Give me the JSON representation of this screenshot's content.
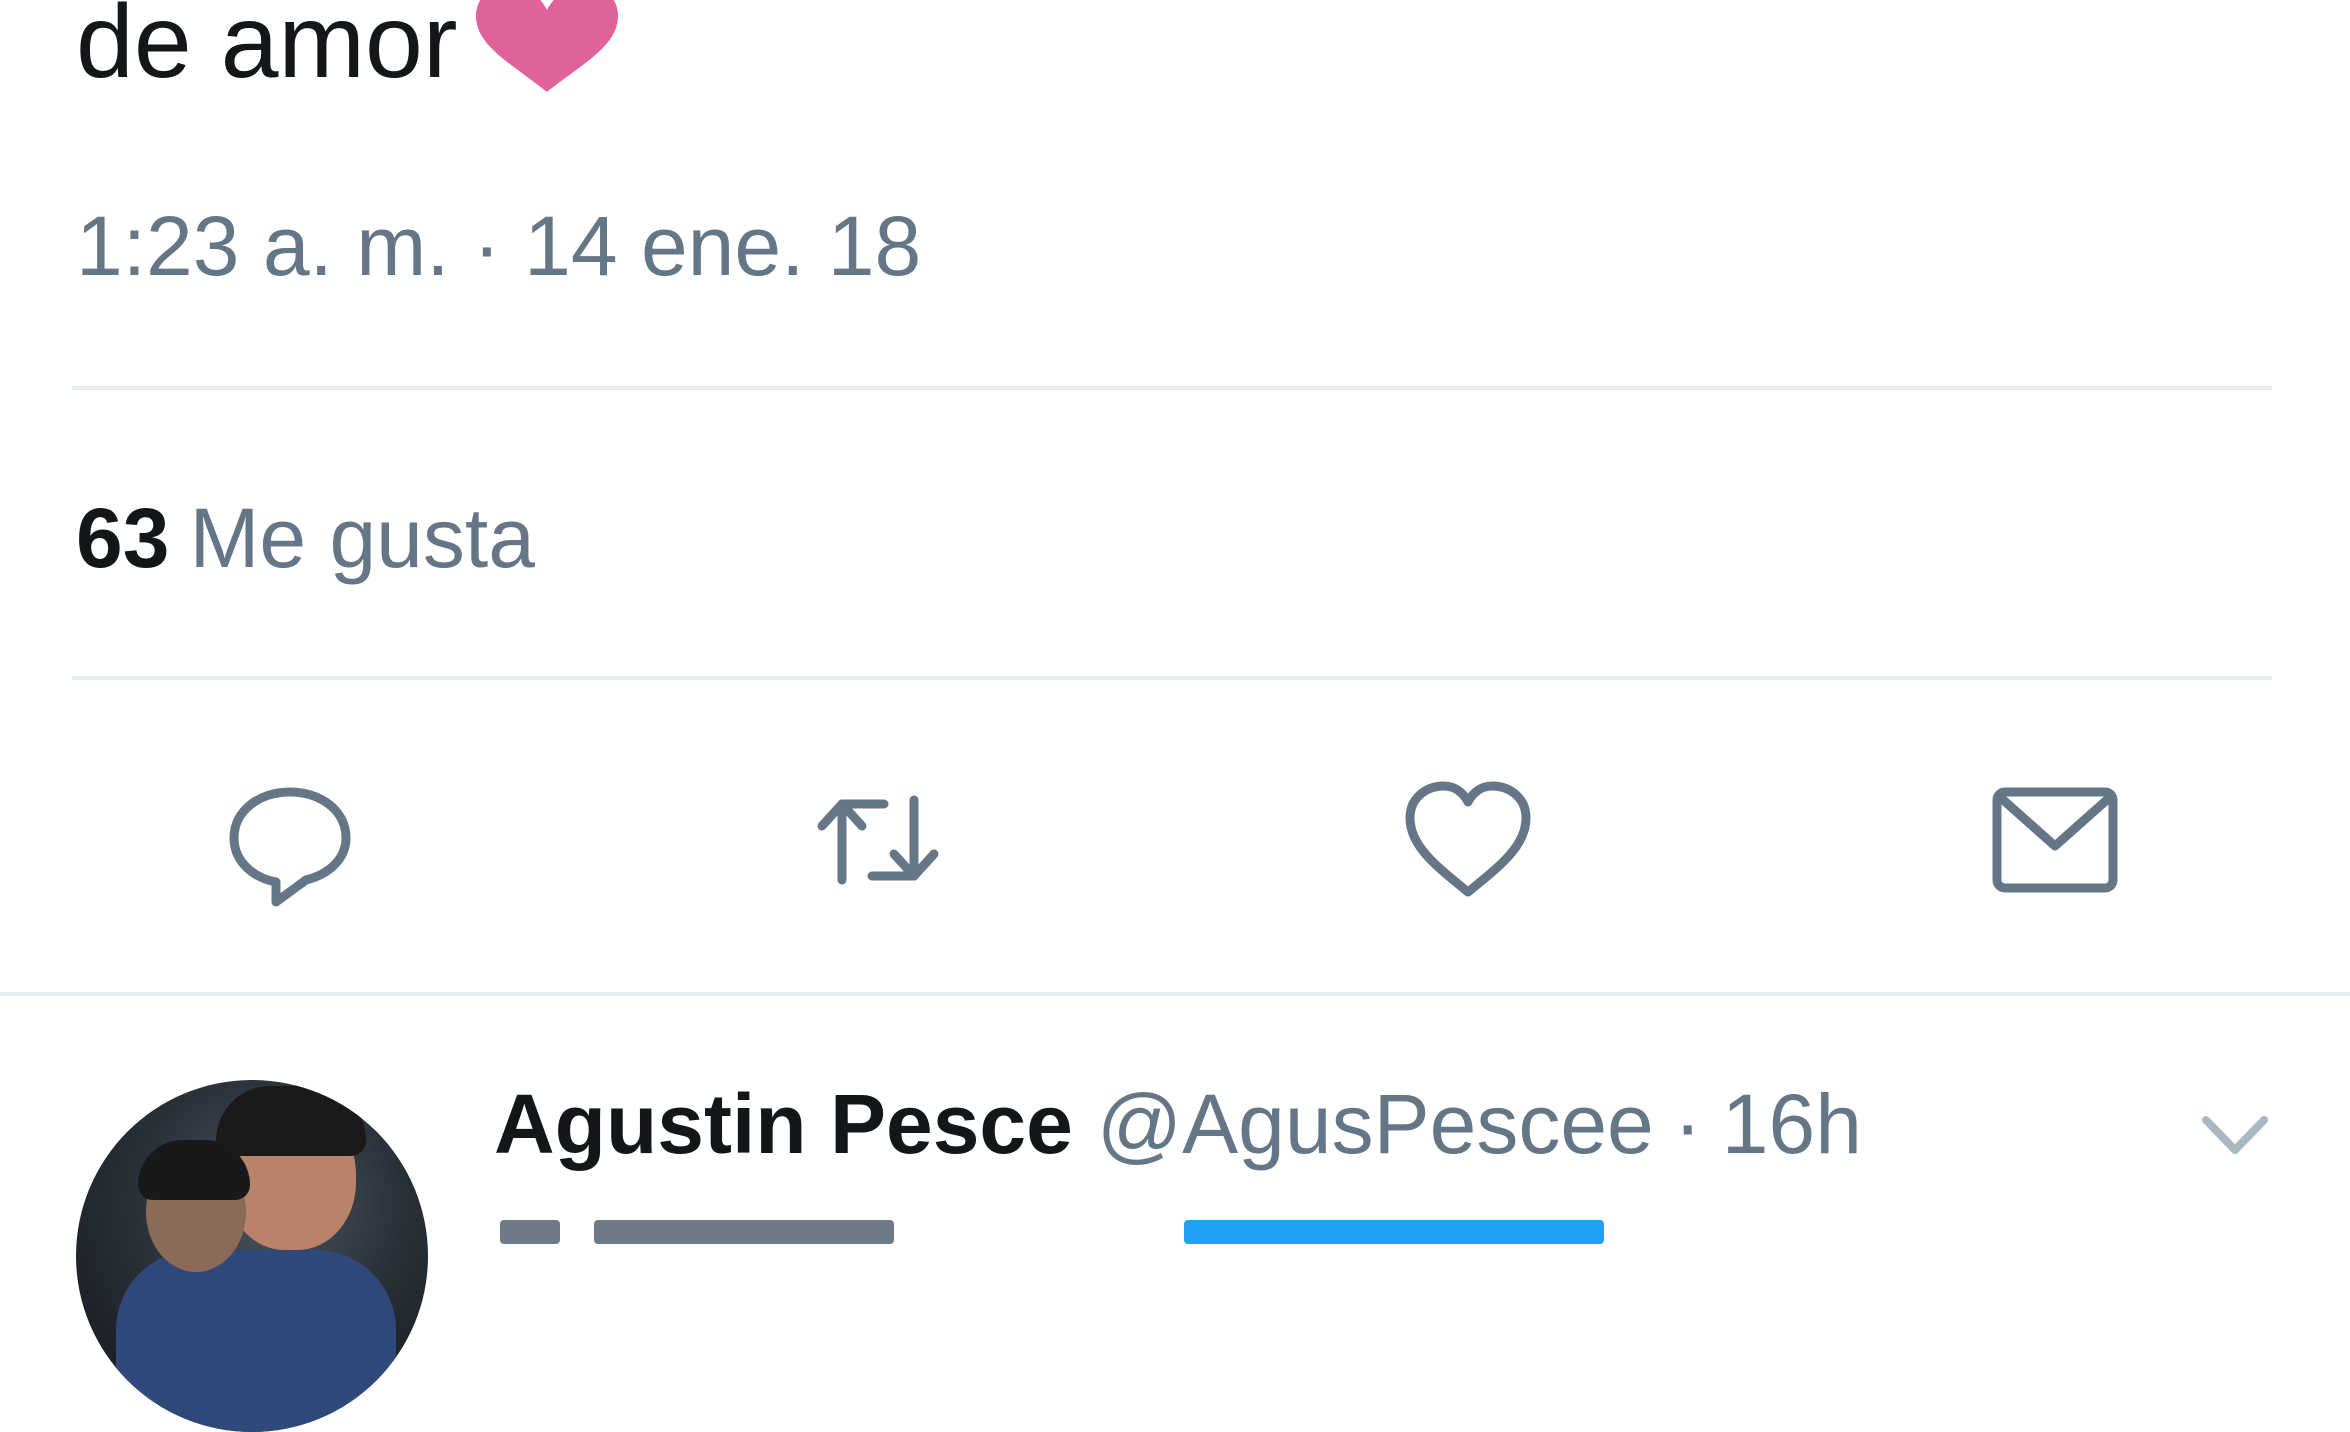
{
  "tweet": {
    "text": "de amor",
    "emoji_color": "#e0629b",
    "timestamp": "1:23 a. m. · 14 ene. 18",
    "likes_count": "63",
    "likes_label": "Me gusta"
  },
  "actions": [
    {
      "icon": "reply-icon"
    },
    {
      "icon": "retweet-icon"
    },
    {
      "icon": "heart-icon"
    },
    {
      "icon": "mail-icon"
    }
  ],
  "reply": {
    "author_name": "Agustin Pesce",
    "author_handle": "@AgusPescee",
    "separator": "·",
    "time": "16h",
    "menu_icon": "chevron-down-icon"
  },
  "colors": {
    "text": "#14171a",
    "secondary": "#657786",
    "icon": "#657786",
    "divider": "#e6ecf0",
    "link": "#1da1f2"
  }
}
